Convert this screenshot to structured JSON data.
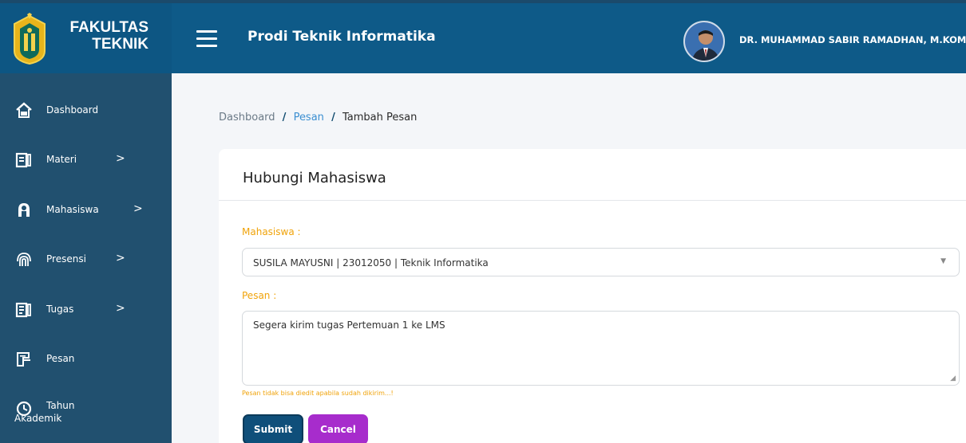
{
  "header": {
    "brand_line1": "FAKULTAS",
    "brand_line2": "TEKNIK",
    "title": "Prodi Teknik Informatika",
    "user_name": "DR. MUHAMMAD SABIR RAMADHAN, M.KOM"
  },
  "sidebar": {
    "items": [
      {
        "label": "Dashboard",
        "icon": "home-icon",
        "has_arrow": false
      },
      {
        "label": "Materi",
        "icon": "book-icon",
        "has_arrow": true
      },
      {
        "label": "Mahasiswa",
        "icon": "user-icon",
        "has_arrow": true
      },
      {
        "label": "Presensi",
        "icon": "fingerprint-icon",
        "has_arrow": true
      },
      {
        "label": "Tugas",
        "icon": "assignment-icon",
        "has_arrow": true
      },
      {
        "label": "Pesan",
        "icon": "message-icon",
        "has_arrow": false
      },
      {
        "label_line1": "Tahun",
        "label_line2": "Akademik",
        "icon": "clock-icon",
        "has_arrow": false
      }
    ],
    "arrow": ">"
  },
  "breadcrumb": {
    "items": [
      "Dashboard",
      "Pesan",
      "Tambah Pesan"
    ],
    "separator": "/"
  },
  "form": {
    "title": "Hubungi Mahasiswa",
    "mahasiswa_label": "Mahasiswa :",
    "mahasiswa_value": "SUSILA MAYUSNI | 23012050 | Teknik Informatika",
    "pesan_label": "Pesan :",
    "pesan_value": "Segera kirim tugas Pertemuan 1 ke LMS",
    "hint": "Pesan tidak bisa diedit apabila sudah dikirim...!",
    "submit_label": "Submit",
    "cancel_label": "Cancel"
  },
  "colors": {
    "header": "#0e5a88",
    "sidebar": "#21506f",
    "label": "#f0a30a",
    "submit": "#0f4f7a",
    "cancel": "#a72ccc"
  }
}
